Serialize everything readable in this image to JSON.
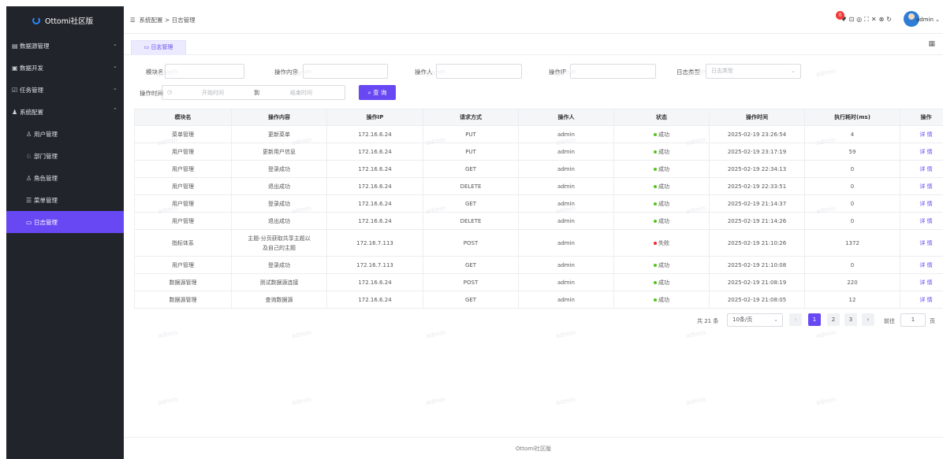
{
  "app": {
    "title": "Ottomi社区版"
  },
  "sidebar": {
    "items": [
      {
        "label": "数据源管理",
        "icon": "database-icon"
      },
      {
        "label": "数据开发",
        "icon": "develop-icon"
      },
      {
        "label": "任务管理",
        "icon": "task-icon"
      },
      {
        "label": "系统配置",
        "icon": "system-config-icon"
      },
      {
        "label": "用户管理",
        "icon": "user-icon"
      },
      {
        "label": "部门管理",
        "icon": "department-icon"
      },
      {
        "label": "角色管理",
        "icon": "role-icon"
      },
      {
        "label": "菜单管理",
        "icon": "menu-icon"
      },
      {
        "label": "日志管理",
        "icon": "log-icon"
      }
    ]
  },
  "header": {
    "breadcrumb": [
      "系统配置",
      "日志管理"
    ],
    "breadcrumb_sep": ">",
    "notification_count": "0",
    "user": "admin"
  },
  "tabs": [
    {
      "label": "日志管理"
    }
  ],
  "filters": {
    "module_label": "模块名",
    "content_label": "操作内容",
    "operator_label": "操作人",
    "ip_label": "操作IP",
    "log_type_label": "日志类型",
    "log_type_placeholder": "日志类型",
    "time_label": "操作时间",
    "start_placeholder": "开始时间",
    "range_sep": "到",
    "end_placeholder": "结束时间",
    "query_button": "查 询"
  },
  "table": {
    "columns": [
      "模块名",
      "操作内容",
      "操作IP",
      "请求方式",
      "操作人",
      "状态",
      "操作时间",
      "执行耗时(ms)",
      "操作"
    ],
    "rows": [
      [
        "菜单管理",
        "更新菜单",
        "172.16.6.24",
        "PUT",
        "admin",
        "成功",
        "2025-02-19 23:26:54",
        "4",
        "详 情"
      ],
      [
        "用户管理",
        "更新用户信息",
        "172.16.6.24",
        "PUT",
        "admin",
        "成功",
        "2025-02-19 23:17:19",
        "59",
        "详 情"
      ],
      [
        "用户管理",
        "登录成功",
        "172.16.6.24",
        "GET",
        "admin",
        "成功",
        "2025-02-19 22:34:13",
        "0",
        "详 情"
      ],
      [
        "用户管理",
        "退出成功",
        "172.16.6.24",
        "DELETE",
        "admin",
        "成功",
        "2025-02-19 22:33:51",
        "0",
        "详 情"
      ],
      [
        "用户管理",
        "登录成功",
        "172.16.6.24",
        "GET",
        "admin",
        "成功",
        "2025-02-19 21:14:37",
        "0",
        "详 情"
      ],
      [
        "用户管理",
        "退出成功",
        "172.16.6.24",
        "DELETE",
        "admin",
        "成功",
        "2025-02-19 21:14:26",
        "0",
        "详 情"
      ],
      [
        "指标体系",
        "主题-分页获取共享主题以及自己的主题",
        "172.16.7.113",
        "POST",
        "admin",
        "失败",
        "2025-02-19 21:10:26",
        "1372",
        "详 情"
      ],
      [
        "用户管理",
        "登录成功",
        "172.16.7.113",
        "GET",
        "admin",
        "成功",
        "2025-02-19 21:10:08",
        "0",
        "详 情"
      ],
      [
        "数据源管理",
        "测试数据源连接",
        "172.16.6.24",
        "POST",
        "admin",
        "成功",
        "2025-02-19 21:08:19",
        "220",
        "详 情"
      ],
      [
        "数据源管理",
        "查询数据源",
        "172.16.6.24",
        "GET",
        "admin",
        "成功",
        "2025-02-19 21:08:05",
        "12",
        "详 情"
      ]
    ]
  },
  "status_colors": {
    "成功": "#52c41a",
    "失败": "#f5222d"
  },
  "pagination": {
    "total": "共 21 条",
    "page_size": "10条/页",
    "pages": [
      "1",
      "2",
      "3"
    ],
    "current": "1",
    "goto_label": "前往",
    "goto_value": "1",
    "page_suffix": "页"
  },
  "watermark": "admin",
  "footer": {
    "text": "Ottomi社区版"
  },
  "colors": {
    "accent": "#6748f2",
    "sidebar_bg": "#21252b"
  }
}
